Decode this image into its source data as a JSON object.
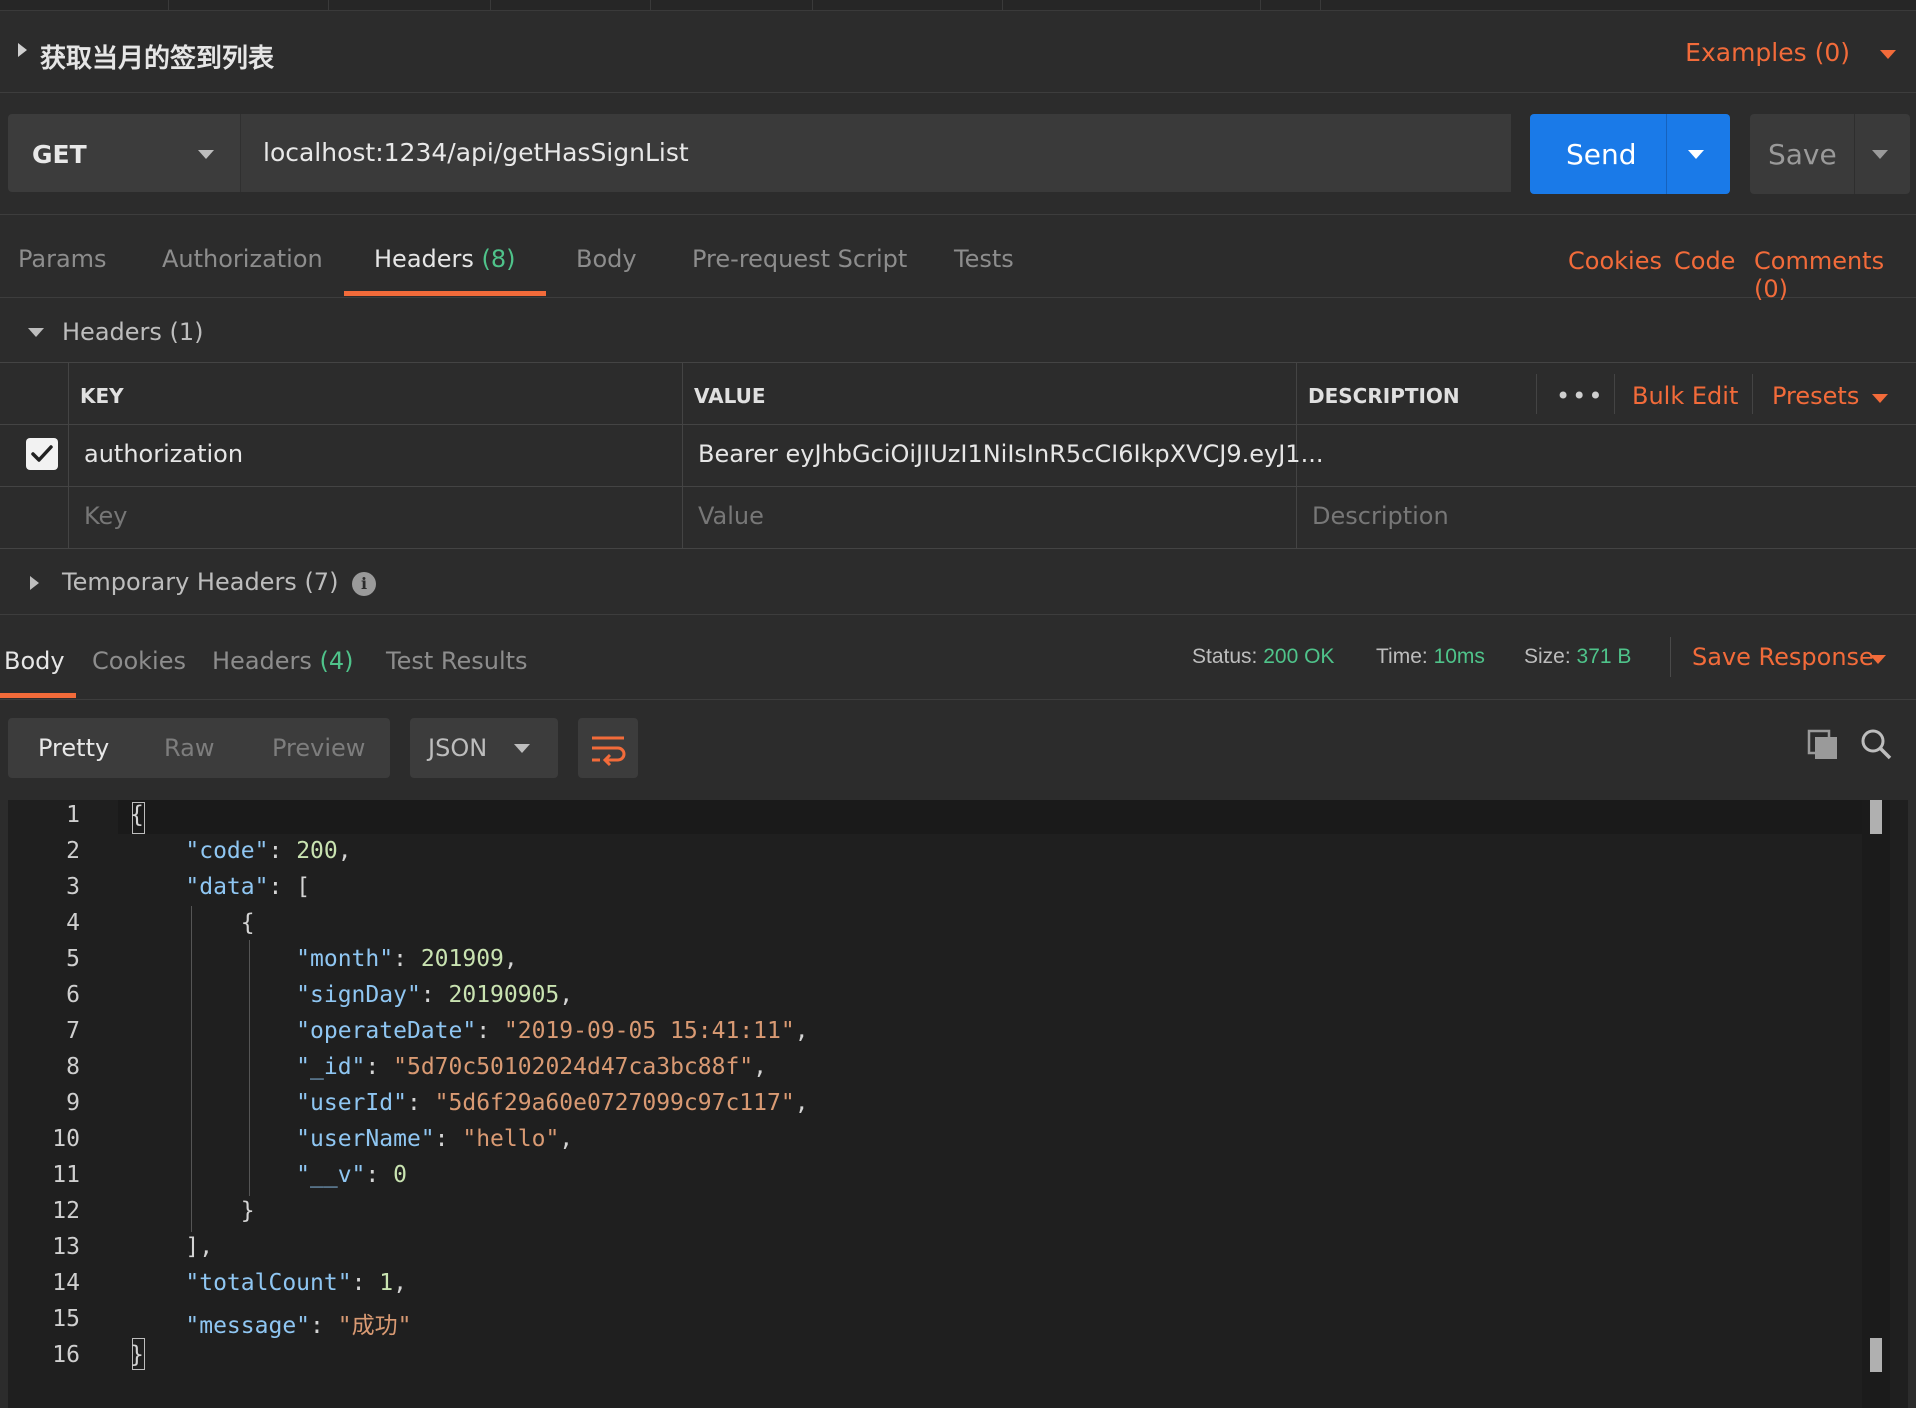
{
  "request": {
    "title": "获取当月的签到列表",
    "examples": "Examples (0)",
    "method": "GET",
    "url": "localhost:1234/api/getHasSignList",
    "send": "Send",
    "save": "Save"
  },
  "request_tabs": {
    "params": "Params",
    "authorization": "Authorization",
    "headers": "Headers",
    "headers_count": "(8)",
    "body": "Body",
    "prerequest": "Pre-request Script",
    "tests": "Tests",
    "cookies": "Cookies",
    "code": "Code",
    "comments": "Comments (0)"
  },
  "headers_section": {
    "title": "Headers (1)",
    "col_key": "KEY",
    "col_value": "VALUE",
    "col_description": "DESCRIPTION",
    "bulk_edit": "Bulk Edit",
    "presets": "Presets",
    "rows": [
      {
        "checked": true,
        "key": "authorization",
        "value": "Bearer eyJhbGciOiJIUzI1NiIsInR5cCI6IkpXVCJ9.eyJ1...",
        "description": ""
      }
    ],
    "placeholder_key": "Key",
    "placeholder_value": "Value",
    "placeholder_description": "Description",
    "temporary": "Temporary Headers (7)"
  },
  "response_tabs": {
    "body": "Body",
    "cookies": "Cookies",
    "headers": "Headers",
    "headers_count": "(4)",
    "test_results": "Test Results",
    "status_label": "Status:",
    "status_value": "200 OK",
    "time_label": "Time:",
    "time_value": "10ms",
    "size_label": "Size:",
    "size_value": "371 B",
    "save_response": "Save Response"
  },
  "view": {
    "pretty": "Pretty",
    "raw": "Raw",
    "preview": "Preview",
    "format": "JSON"
  },
  "editor": {
    "line_numbers": [
      "1",
      "2",
      "3",
      "4",
      "5",
      "6",
      "7",
      "8",
      "9",
      "10",
      "11",
      "12",
      "13",
      "14",
      "15",
      "16"
    ],
    "lines": {
      "l1": "{",
      "l2_key": "\"code\"",
      "l2_val": "200",
      "l3_key": "\"data\"",
      "l3_val": "[",
      "l4": "{",
      "l5_key": "\"month\"",
      "l5_val": "201909",
      "l6_key": "\"signDay\"",
      "l6_val": "20190905",
      "l7_key": "\"operateDate\"",
      "l7_val": "\"2019-09-05 15:41:11\"",
      "l8_key": "\"_id\"",
      "l8_val": "\"5d70c50102024d47ca3bc88f\"",
      "l9_key": "\"userId\"",
      "l9_val": "\"5d6f29a60e0727099c97c117\"",
      "l10_key": "\"userName\"",
      "l10_val": "\"hello\"",
      "l11_key": "\"__v\"",
      "l11_val": "0",
      "l12": "}",
      "l13": "],",
      "l14_key": "\"totalCount\"",
      "l14_val": "1",
      "l15_key": "\"message\"",
      "l15_val": "\"成功\"",
      "l16": "}"
    }
  },
  "colors": {
    "accent": "#f26b3a",
    "send": "#1a7ae8",
    "status_green": "#4fc38a",
    "background": "#2c2c2c",
    "editor_bg": "#1f1f1f"
  }
}
